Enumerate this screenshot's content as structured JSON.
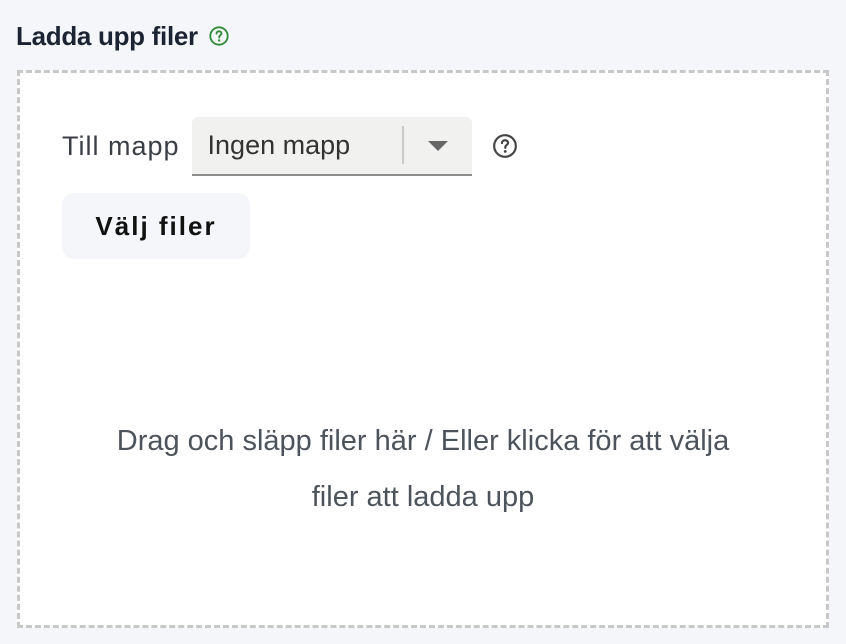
{
  "header": {
    "title": "Ladda upp filer"
  },
  "folder": {
    "label": "Till mapp",
    "selected": "Ingen mapp"
  },
  "actions": {
    "choose_files": "Välj filer"
  },
  "dropzone": {
    "line1": "Drag och släpp filer här / Eller klicka för att välja",
    "line2": "filer att ladda upp"
  },
  "icons": {
    "title_help": "help-circle-icon",
    "folder_help": "help-circle-icon",
    "select_arrow": "caret-down-icon"
  },
  "colors": {
    "help_green": "#2e8b3a",
    "help_gray": "#444444",
    "dashed_border": "#c8c8c8"
  }
}
